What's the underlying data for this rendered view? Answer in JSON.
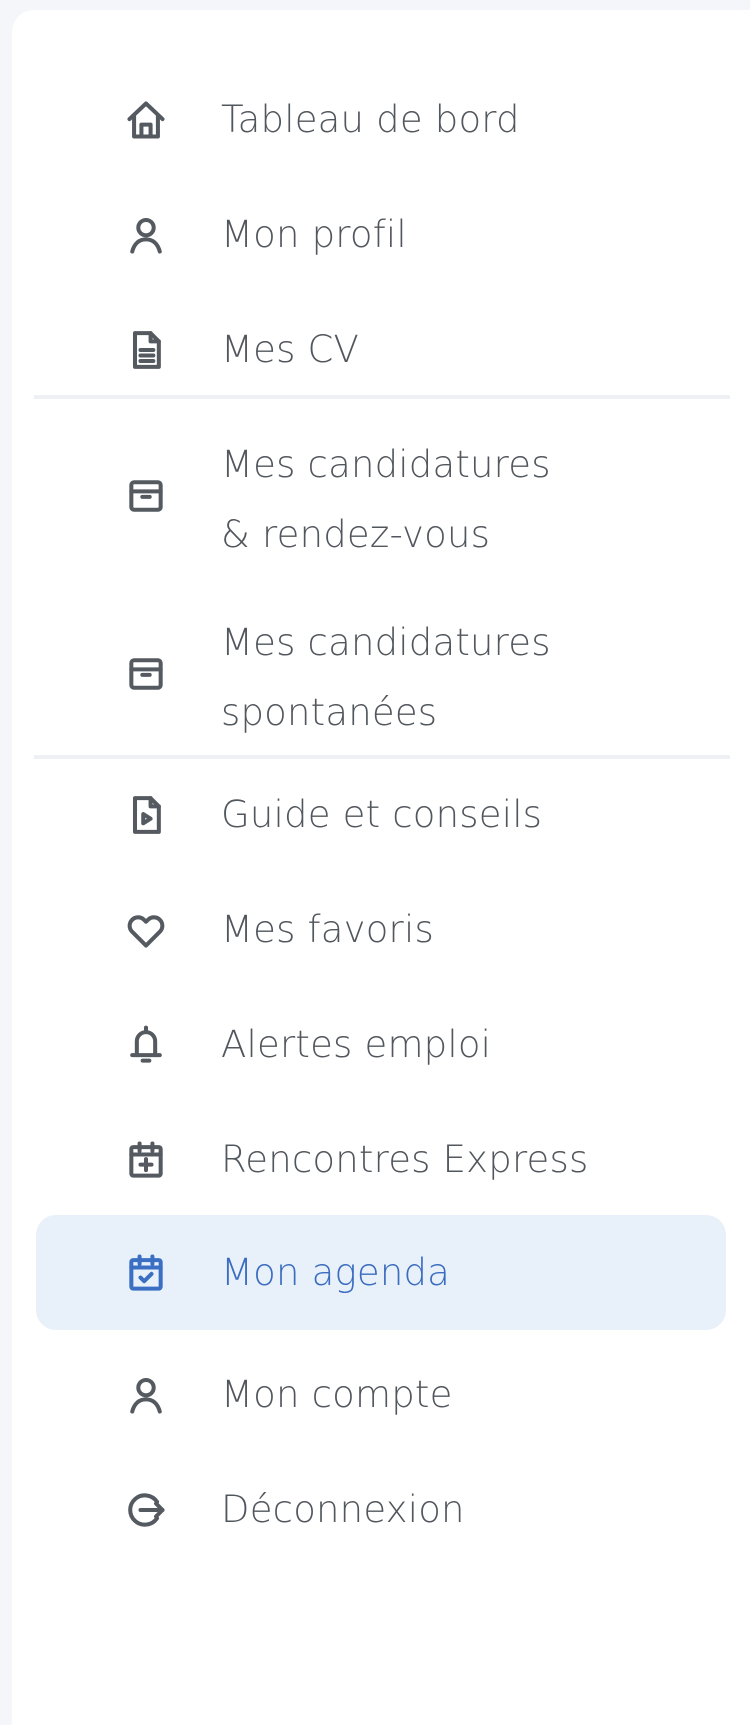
{
  "menu": {
    "items": [
      {
        "label": "Tableau de bord",
        "icon": "home-icon"
      },
      {
        "label": "Mon profil",
        "icon": "user-icon"
      },
      {
        "label": "Mes CV",
        "icon": "document-icon"
      },
      {
        "label": "Mes candidatures\n& rendez-vous",
        "icon": "box-icon"
      },
      {
        "label": "Mes candidatures\nspontanées",
        "icon": "box-icon"
      },
      {
        "label": "Guide et conseils",
        "icon": "video-file-icon"
      },
      {
        "label": "Mes favoris",
        "icon": "heart-icon"
      },
      {
        "label": "Alertes emploi",
        "icon": "bell-icon"
      },
      {
        "label": "Rencontres Express",
        "icon": "calendar-plus-icon"
      },
      {
        "label": "Mon agenda",
        "icon": "calendar-check-icon",
        "active": true
      },
      {
        "label": "Mon compte",
        "icon": "user-icon"
      },
      {
        "label": "Déconnexion",
        "icon": "logout-icon"
      }
    ]
  },
  "colors": {
    "active_background": "#e8f0fa",
    "active_text": "#3a6cc0",
    "text": "#52575d",
    "divider": "#eef0f3"
  }
}
